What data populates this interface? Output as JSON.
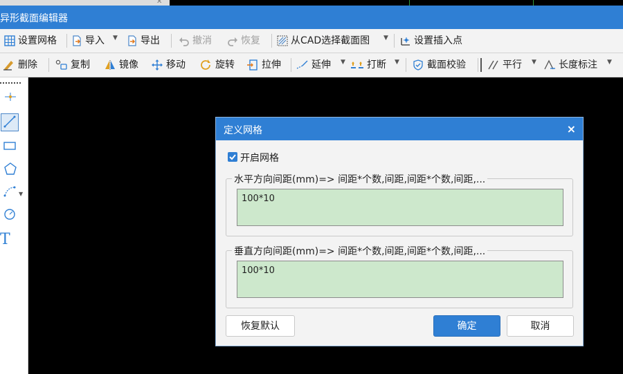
{
  "app": {
    "title": "异形截面编辑器"
  },
  "toolbar1": [
    {
      "label": "设置网格",
      "icon": "grid-icon"
    },
    {
      "label": "导入",
      "icon": "import-icon",
      "dropdown": true
    },
    {
      "label": "导出",
      "icon": "export-icon"
    },
    {
      "label": "撤消",
      "icon": "undo-icon",
      "disabled": true
    },
    {
      "label": "恢复",
      "icon": "redo-icon",
      "disabled": true
    },
    {
      "label": "从CAD选择截面图",
      "icon": "cad-select-icon",
      "dropdown": true
    },
    {
      "label": "设置插入点",
      "icon": "insert-point-icon"
    }
  ],
  "toolbar2": [
    {
      "label": "删除",
      "icon": "delete-icon"
    },
    {
      "label": "复制",
      "icon": "copy-icon"
    },
    {
      "label": "镜像",
      "icon": "mirror-icon"
    },
    {
      "label": "移动",
      "icon": "move-icon"
    },
    {
      "label": "旋转",
      "icon": "rotate-icon"
    },
    {
      "label": "拉伸",
      "icon": "stretch-icon"
    },
    {
      "label": "延伸",
      "icon": "extend-icon",
      "dropdown": true
    },
    {
      "label": "打断",
      "icon": "break-icon",
      "dropdown": true
    },
    {
      "label": "截面校验",
      "icon": "section-check-icon"
    },
    {
      "label": "平行",
      "icon": "parallel-icon",
      "dropdown": true
    },
    {
      "label": "长度标注",
      "icon": "length-dimension-icon",
      "dropdown": true
    }
  ],
  "left_tools": [
    "point-tool-icon",
    "line-tool-icon",
    "rectangle-tool-icon",
    "polygon-tool-icon",
    "arc-tool-icon",
    "circle-tool-icon",
    "text-tool-icon"
  ],
  "left_tools_text": {
    "text": "T"
  },
  "dialog": {
    "title": "定义网格",
    "close": "×",
    "enable_grid": {
      "label": "开启网格",
      "checked": true
    },
    "horizontal": {
      "legend": "水平方向间距(mm)=> 间距*个数,间距,间距*个数,间距,...",
      "value": "100*10"
    },
    "vertical": {
      "legend": "垂直方向间距(mm)=> 间距*个数,间距,间距*个数,间距,...",
      "value": "100*10"
    },
    "buttons": {
      "reset": "恢复默认",
      "ok": "确定",
      "cancel": "取消"
    }
  },
  "colors": {
    "accent": "#2f7fd4",
    "input_bg": "#cde8cc",
    "canvas": "#000000"
  }
}
